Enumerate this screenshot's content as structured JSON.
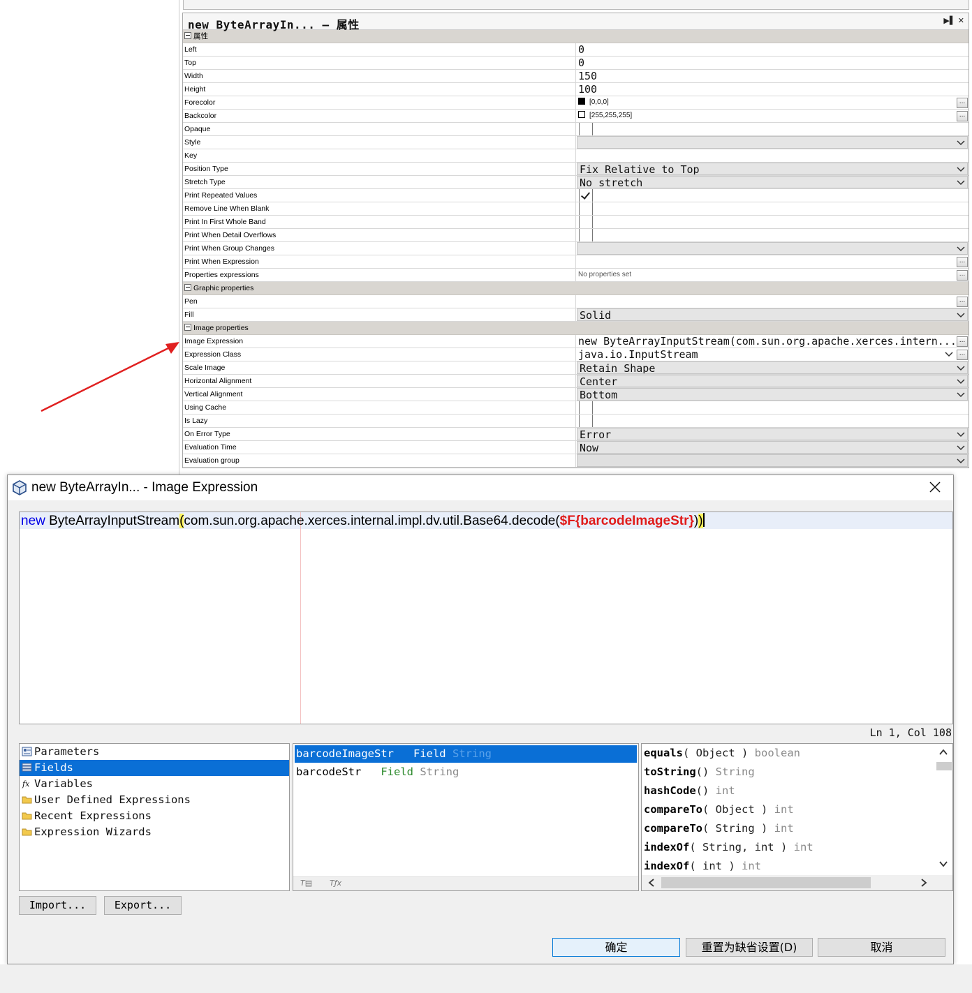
{
  "properties_panel": {
    "title": "new ByteArrayIn... – 属性",
    "section_main": "属性",
    "rows_main": [
      {
        "key": "Left",
        "value": "0",
        "kind": "text"
      },
      {
        "key": "Top",
        "value": "0",
        "kind": "text"
      },
      {
        "key": "Width",
        "value": "150",
        "kind": "text"
      },
      {
        "key": "Height",
        "value": "100",
        "kind": "text"
      },
      {
        "key": "Forecolor",
        "value": "[0,0,0]",
        "kind": "color",
        "swatch": "#000000"
      },
      {
        "key": "Backcolor",
        "value": "[255,255,255]",
        "kind": "color",
        "swatch": "#ffffff"
      },
      {
        "key": "Opaque",
        "value": "",
        "kind": "checkbox",
        "checked": false
      },
      {
        "key": "Style",
        "value": "",
        "kind": "combo"
      },
      {
        "key": "Key",
        "value": "",
        "kind": "text"
      },
      {
        "key": "Position Type",
        "value": "Fix Relative to Top",
        "kind": "combo"
      },
      {
        "key": "Stretch Type",
        "value": "No stretch",
        "kind": "combo"
      },
      {
        "key": "Print Repeated Values",
        "value": "",
        "kind": "checkbox",
        "checked": true
      },
      {
        "key": "Remove Line When Blank",
        "value": "",
        "kind": "checkbox",
        "checked": false
      },
      {
        "key": "Print In First Whole Band",
        "value": "",
        "kind": "checkbox",
        "checked": false
      },
      {
        "key": "Print When Detail Overflows",
        "value": "",
        "kind": "checkbox",
        "checked": false
      },
      {
        "key": "Print When Group Changes",
        "value": "",
        "kind": "combo"
      },
      {
        "key": "Print When Expression",
        "value": "",
        "kind": "dots"
      },
      {
        "key": "Properties expressions",
        "value": "No properties set",
        "kind": "dots-muted"
      }
    ],
    "section_graphic": "Graphic properties",
    "rows_graphic": [
      {
        "key": "Pen",
        "value": "",
        "kind": "dots"
      },
      {
        "key": "Fill",
        "value": "Solid",
        "kind": "combo"
      }
    ],
    "section_image": "Image properties",
    "rows_image": [
      {
        "key": "Image Expression",
        "value": "new ByteArrayInputStream(com.sun.org.apache.xerces.intern...",
        "kind": "dots-text"
      },
      {
        "key": "Expression Class",
        "value": "java.io.InputStream",
        "kind": "combo-dots"
      },
      {
        "key": "Scale Image",
        "value": "Retain Shape",
        "kind": "combo"
      },
      {
        "key": "Horizontal Alignment",
        "value": "Center",
        "kind": "combo"
      },
      {
        "key": "Vertical Alignment",
        "value": "Bottom",
        "kind": "combo"
      },
      {
        "key": "Using Cache",
        "value": "",
        "kind": "checkbox",
        "checked": false
      },
      {
        "key": "Is Lazy",
        "value": "",
        "kind": "checkbox",
        "checked": false
      },
      {
        "key": "On Error Type",
        "value": "Error",
        "kind": "combo"
      },
      {
        "key": "Evaluation Time",
        "value": "Now",
        "kind": "combo"
      },
      {
        "key": "Evaluation group",
        "value": "",
        "kind": "combo-disabled"
      }
    ]
  },
  "dialog": {
    "title": "new ByteArrayIn... - Image Expression",
    "editor": {
      "kw": "new",
      "part1": " ByteArrayInputStream",
      "paren_open": "(",
      "part2": "com.sun.org.apache.xerces.internal.impl.dv.util.Base64.decode(",
      "field": "$F{barcodeImageStr}",
      "part3": ")",
      "paren_close": ")"
    },
    "status": "Ln 1,  Col 108",
    "categories": [
      {
        "label": "Parameters",
        "icon": "parameters-icon",
        "selected": false
      },
      {
        "label": "Fields",
        "icon": "fields-icon",
        "selected": true
      },
      {
        "label": "Variables",
        "icon": "variables-icon",
        "selected": false
      },
      {
        "label": "User Defined Expressions",
        "icon": "folder-icon",
        "selected": false
      },
      {
        "label": "Recent Expressions",
        "icon": "folder-icon",
        "selected": false
      },
      {
        "label": "Expression Wizards",
        "icon": "folder-icon",
        "selected": false
      }
    ],
    "fields": [
      {
        "name": "barcodeImageStr",
        "type": "Field",
        "cls": "String",
        "selected": true
      },
      {
        "name": "barcodeStr",
        "type": "Field",
        "cls": "String",
        "selected": false
      }
    ],
    "methods": [
      {
        "name": "equals",
        "args": "( Object )",
        "ret": "boolean"
      },
      {
        "name": "toString",
        "args": "()",
        "ret": "String"
      },
      {
        "name": "hashCode",
        "args": "()",
        "ret": "int"
      },
      {
        "name": "compareTo",
        "args": "( Object )",
        "ret": "int"
      },
      {
        "name": "compareTo",
        "args": "( String )",
        "ret": "int"
      },
      {
        "name": "indexOf",
        "args": "( String, int )",
        "ret": "int"
      },
      {
        "name": "indexOf",
        "args": "( int )",
        "ret": "int"
      }
    ],
    "buttons": {
      "import": "Import...",
      "export": "Export...",
      "ok": "确定",
      "reset": "重置为缺省设置(D)",
      "cancel": "取消"
    }
  },
  "colors": {
    "selection": "#0a6fd6",
    "keyword": "#0000e6",
    "field_expr": "#e01b1b",
    "arrow": "#e02020"
  }
}
